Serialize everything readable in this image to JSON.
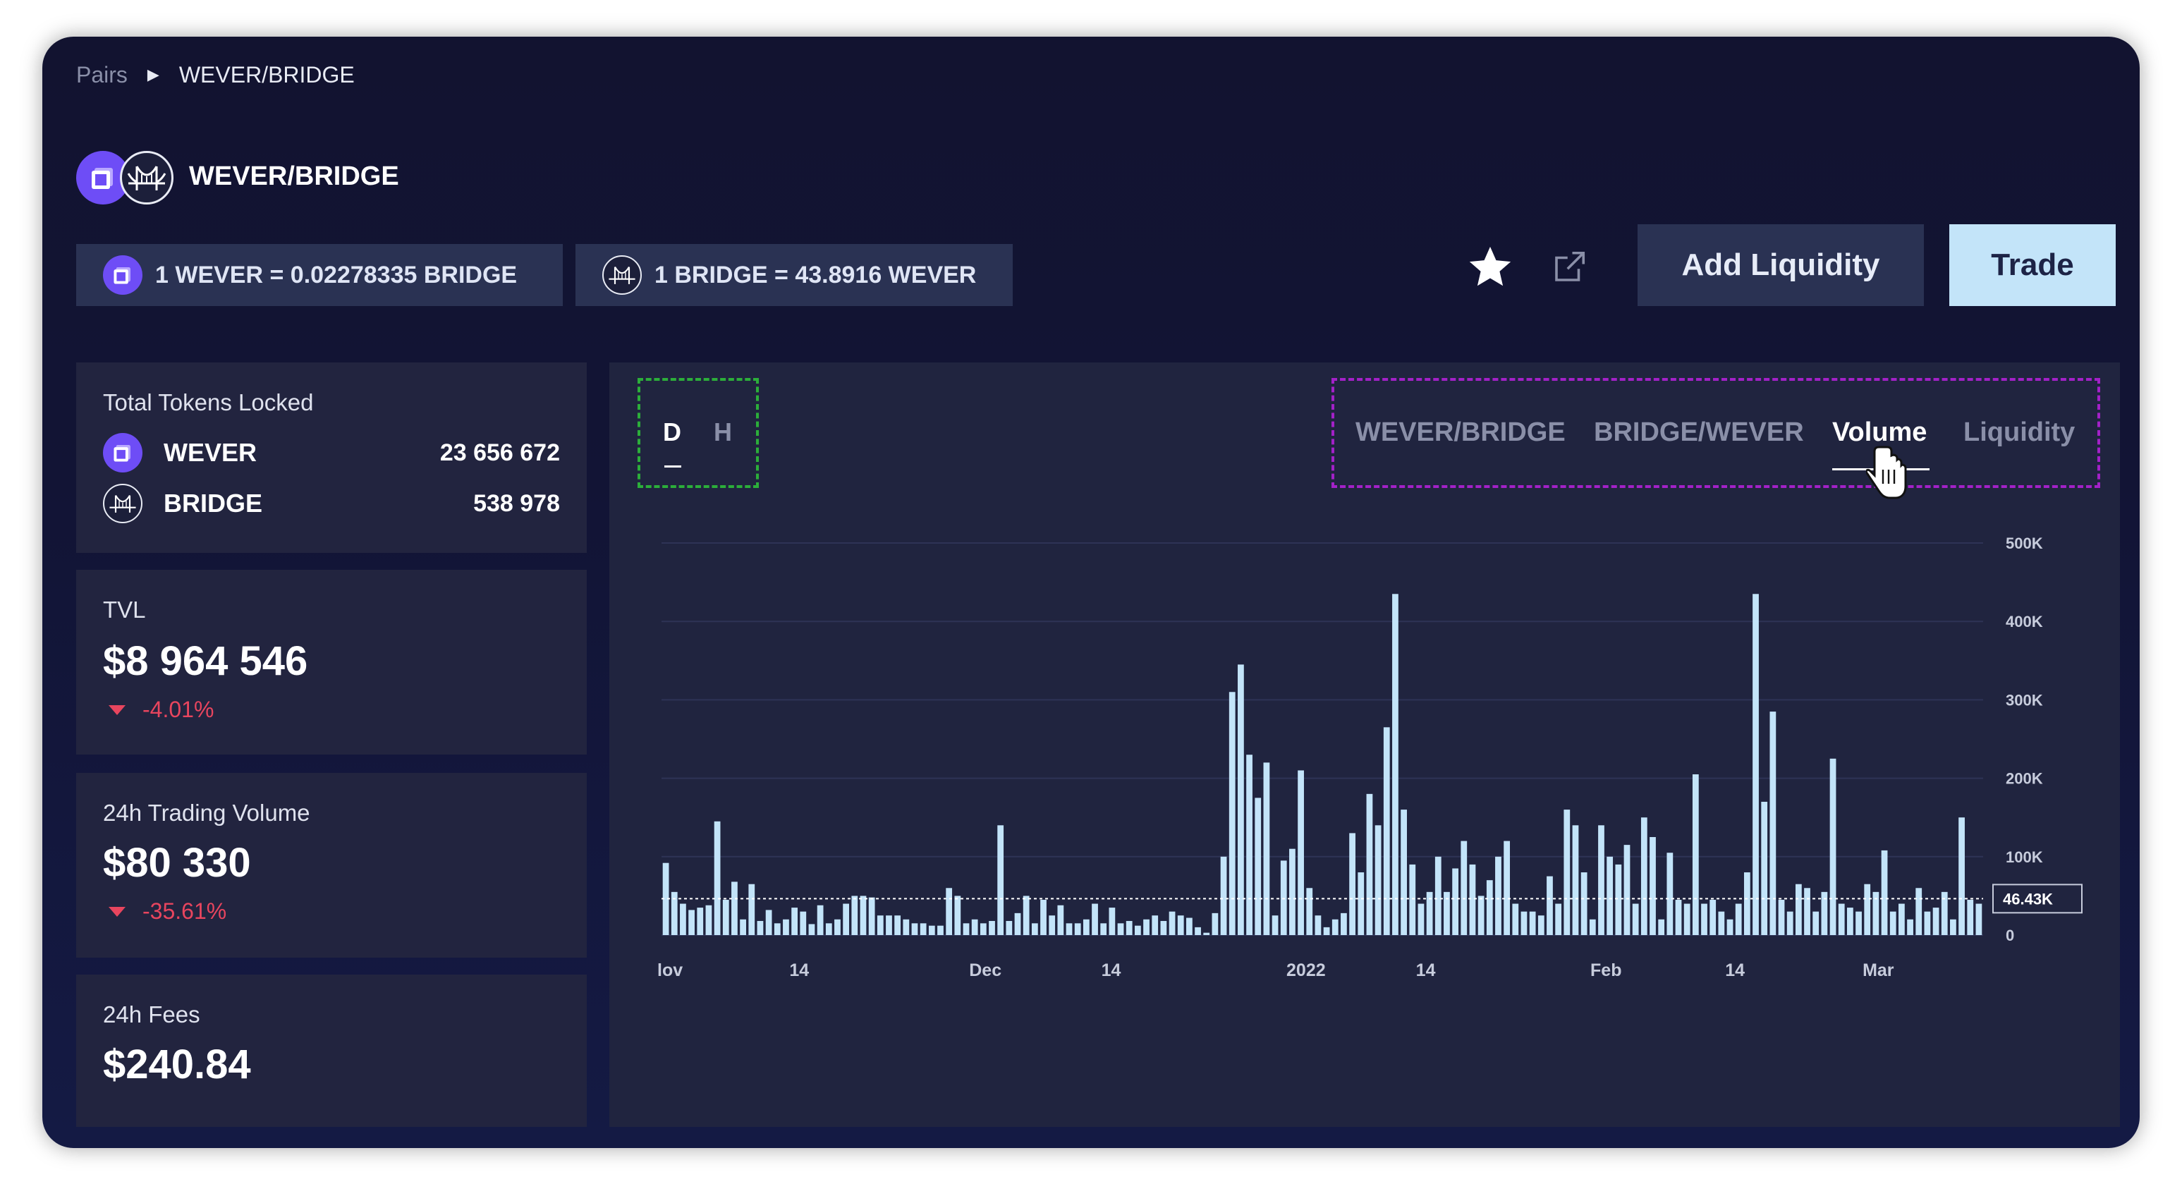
{
  "breadcrumb": {
    "root": "Pairs",
    "current": "WEVER/BRIDGE"
  },
  "pair": {
    "title": "WEVER/BRIDGE"
  },
  "rates": {
    "rate1": "1 WEVER = 0.02278335 BRIDGE",
    "rate2": "1 BRIDGE = 43.8916 WEVER"
  },
  "actions": {
    "add_liquidity": "Add Liquidity",
    "trade": "Trade",
    "star_icon": "star-icon",
    "external_icon": "external-link-icon"
  },
  "colors": {
    "accent": "#6e4df6",
    "trade_button": "#c3e4f9",
    "bars": "#c3e4f9",
    "negative": "#e8455e"
  },
  "locked": {
    "label": "Total Tokens Locked",
    "tokens": [
      {
        "name": "WEVER",
        "value": "23 656 672"
      },
      {
        "name": "BRIDGE",
        "value": "538 978"
      }
    ]
  },
  "tvl": {
    "label": "TVL",
    "value": "$8 964 546",
    "change": "-4.01%"
  },
  "volume24h": {
    "label": "24h Trading Volume",
    "value": "$80 330",
    "change": "-35.61%"
  },
  "fees24h": {
    "label": "24h Fees",
    "value": "$240.84"
  },
  "timeframe": {
    "options": [
      "D",
      "H"
    ],
    "selected": "D"
  },
  "chart_tabs": {
    "tabs": [
      "WEVER/BRIDGE",
      "BRIDGE/WEVER",
      "Volume",
      "Liquidity"
    ],
    "selected": "Volume"
  },
  "chart_data": {
    "type": "bar",
    "x_tick_labels": [
      "lov",
      "14",
      "Dec",
      "14",
      "2022",
      "14",
      "Feb",
      "14",
      "Mar"
    ],
    "y_tick_labels": [
      "500K",
      "400K",
      "300K",
      "200K",
      "100K",
      "0"
    ],
    "ylim": [
      0,
      500000
    ],
    "current_value_label": "46.43K",
    "current_value": 46430,
    "values": [
      92000,
      55000,
      40000,
      32000,
      35000,
      38000,
      145000,
      45000,
      68000,
      20000,
      65000,
      18000,
      32000,
      15000,
      20000,
      35000,
      30000,
      14000,
      38000,
      15000,
      20000,
      40000,
      50000,
      50000,
      48000,
      25000,
      25000,
      25000,
      20000,
      15000,
      15000,
      12000,
      12000,
      60000,
      50000,
      15000,
      20000,
      15000,
      18000,
      140000,
      18000,
      28000,
      50000,
      15000,
      45000,
      25000,
      38000,
      15000,
      15000,
      20000,
      40000,
      15000,
      35000,
      15000,
      18000,
      12000,
      20000,
      25000,
      18000,
      30000,
      25000,
      22000,
      10000,
      3000,
      28000,
      100000,
      310000,
      345000,
      230000,
      175000,
      220000,
      25000,
      95000,
      110000,
      210000,
      60000,
      25000,
      10000,
      20000,
      28000,
      130000,
      80000,
      180000,
      140000,
      265000,
      435000,
      160000,
      90000,
      40000,
      55000,
      100000,
      55000,
      85000,
      120000,
      90000,
      50000,
      70000,
      100000,
      120000,
      40000,
      30000,
      30000,
      25000,
      75000,
      40000,
      160000,
      140000,
      80000,
      20000,
      140000,
      100000,
      90000,
      115000,
      40000,
      150000,
      125000,
      20000,
      105000,
      45000,
      40000,
      205000,
      40000,
      45000,
      30000,
      20000,
      40000,
      80000,
      435000,
      170000,
      285000,
      45000,
      30000,
      65000,
      60000,
      30000,
      55000,
      225000,
      40000,
      35000,
      30000,
      65000,
      55000,
      108000,
      30000,
      40000,
      20000,
      60000,
      30000,
      35000,
      55000,
      20000,
      150000,
      45000,
      40000
    ]
  }
}
